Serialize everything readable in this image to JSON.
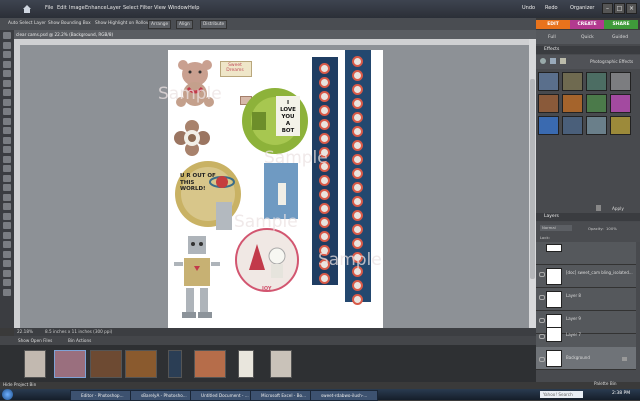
{
  "menubar": {
    "items": [
      "File",
      "Edit",
      "Image",
      "Enhance",
      "Layer",
      "Select",
      "Filter",
      "View",
      "Window",
      "Help"
    ],
    "undo": "Undo",
    "redo": "Redo",
    "organizer": "Organizer",
    "window_buttons": [
      "–",
      "□",
      "×"
    ]
  },
  "options_bar": {
    "auto_select": "Auto Select Layer",
    "bounding_box": "Show Bounding Box",
    "highlight": "Show Highlight on Rollover",
    "arrange": "Arrange",
    "align": "Align",
    "distribute": "Distribute"
  },
  "modes": {
    "edit": "EDIT",
    "create": "CREATE",
    "share": "SHARE",
    "edit_color": "#e8731c",
    "create_color": "#b23a8f",
    "share_color": "#3f9a3a"
  },
  "subtabs": [
    "Full",
    "Quick",
    "Guided"
  ],
  "document": {
    "title": "clear cams.psd @ 22.2% (Background, RGB/8)",
    "zoom": "22.18%",
    "doc_info": "8.5 inches x 11 inches (300 ppi)"
  },
  "canvas_items": {
    "sweet_dreams": "Sweet Dreams",
    "love_bot": "I LOVE YOU A BOT",
    "out_of_world": "U R OUT OF THIS WORLD!",
    "joy": "JOY",
    "watermark": "Sample"
  },
  "effects": {
    "title": "Effects",
    "category": "Photographic Effects",
    "apply": "Apply",
    "swatch_colors": [
      "#5a6f8c",
      "#6f6a50",
      "#4c6d63",
      "#7c7d80",
      "#8a5a3a",
      "#a5642c",
      "#4b7a4a",
      "#a34aa0",
      "#3a6ab0",
      "#4a5f7a",
      "#6a7f8a",
      "#9c8a3a"
    ]
  },
  "layers": {
    "title": "Layers",
    "blend_mode": "Normal",
    "opacity_label": "Opacity:",
    "opacity_value": "100%",
    "lock_label": "Lock:",
    "rows": [
      "",
      "[doc] sweet_cam bling_isolated...",
      "Layer 8",
      "Layer 9",
      "Layer 7",
      "Background"
    ]
  },
  "project_bin": {
    "show_open_files": "Show Open Files",
    "bin_actions": "Bin Actions",
    "hide_project_bin": "Hide Project Bin",
    "palette_bin": "Palette Bin"
  },
  "taskbar": {
    "tasks": [
      "Editor - Photoshop...",
      "sBarelyA - Photosho...",
      "Untitled Document - ...",
      "Microsoft Excel - Bo...",
      "sweet-rdabwo-ilush-..."
    ],
    "search_placeholder": "Yahoo! Search",
    "clock": "2:38 PM"
  }
}
